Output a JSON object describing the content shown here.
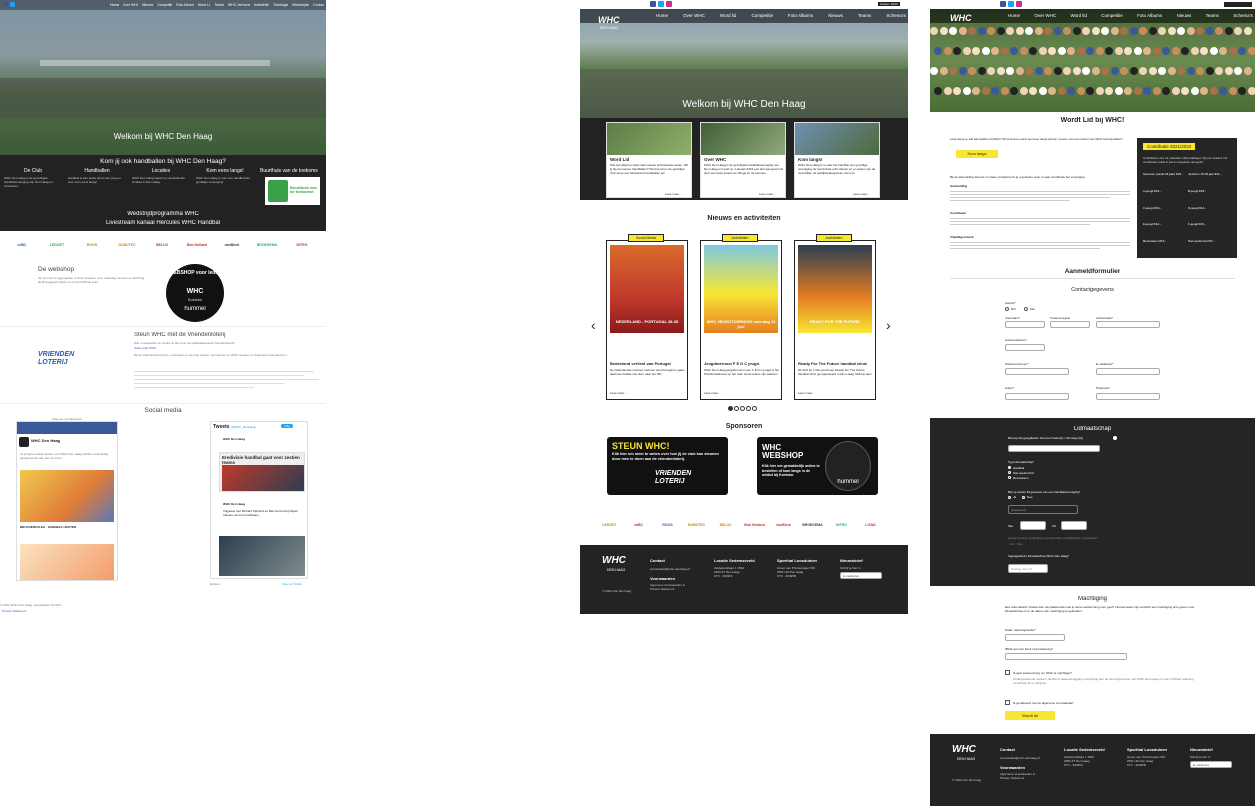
{
  "colors": {
    "accent_yellow": "#f7e733",
    "dark_bg": "#232323",
    "link_blue": "#2a5db0",
    "facebook_blue": "#3b5998"
  },
  "panel1": {
    "nav": [
      "Home",
      "Over WHC",
      "Nieuws",
      "Competitie",
      "Foto Albums",
      "Word Lid",
      "Teams",
      "WHC-Verhuren",
      "Activiteiten",
      "Trainingen",
      "Wedstrijden",
      "Contact"
    ],
    "hero_title": "Welkom bij WHC Den Haag",
    "question": "Kom jij ook handballen bij WHC Den Haag?",
    "columns": [
      {
        "title": "De Club",
        "text": "WHC Den Haag is de gezelligste handbalvereniging van Den Haag en omstreken."
      },
      {
        "title": "Handballen",
        "text": "Handbal is een leuke sport voor jong en oud. Kom eens langs!"
      },
      {
        "title": "Locaties",
        "text": "WHC Den Haag speelt op verschillende locaties in Den Haag."
      },
      {
        "title": "Kom eens langs!",
        "text": "WHC Den Haag is voor een handbal dat gezellige vereniging!"
      },
      {
        "title": "Buurthuis van de toekomst",
        "text": ""
      }
    ],
    "buurthuis_logo": "Buurthuis van de toekomst",
    "wedstrijd": "Wedstrijdprogramma WHC",
    "livestream": "Livestream kanaal Hercules WHC Handbal",
    "sponsors": [
      "vdBC",
      "LEDOET",
      "ROOS",
      "NOBUTEC",
      "BELUX",
      "Bob Holland",
      "vanBlerk",
      "BROEKEMA",
      "INTRO"
    ],
    "webshop_title": "De webshop",
    "webshop_text": "Op ons wimm leggi kleden of al de Koelsior, voor vaderdag mensen en dutching kleding gigand belast en op de KOM jou stad.",
    "webshop_badge": "WEBSHOP voor leden",
    "webshop_brand": "hummel",
    "webshop_club": "WHC",
    "webshop_partner": "Koelsior",
    "loterij_title": "Steun WHC met de Vriendenloterij",
    "loterij_q": "Wilt u meespelen en spelen je als meer de geldwaardewerk Vriendenloterij?",
    "loterij_link": "Steun mijn WHC",
    "loterij_text": "Bij de Vriendenloterij kunt u meedoen en uw prijs winnen. Het winnen en WHC steunen en financieel ondersteunen.",
    "loterij_logo": "VRIENDEN LOTERIJ",
    "social_title": "Social media",
    "fb_caption": "Volg ons op Facebook",
    "fb_page": "WHC Den Haag",
    "fb_post": "Je jongste enkele spelers van WHC Den Haag hebben vanmiddag deelgenomen aan een toernooi.",
    "fb_event": "BRUCHERCULES - HANDBAL HOUTEN",
    "tweets_header": "Tweets",
    "tweets_by": "@WHC_DenHaag",
    "tweets_follow": "Volg",
    "tweet1_name": "WHC Den Haag",
    "tweet1_title": "Eredivisie handbal gaat voor zestien teams",
    "tweet2_name": "WHC Den Haag",
    "tweet2_text": "Vrijgewel met Richard Sijbrand en Bart de Koning blijven trainers van het hoofdteam.",
    "tweet_embed": "Embed",
    "tweet_view": "View on Twitter",
    "copyright": "© 2022 WHC Den Haag. Aangesloten bij NHV.",
    "footer_links": "Privacy Statement"
  },
  "panel2": {
    "topbar_search": "Zoeken WHC",
    "logo": "WHC",
    "logo_sub": "DEN HAAG",
    "nav": [
      "Home",
      "Over WHC",
      "Word lid",
      "Competitie",
      "Foto Albums",
      "Nieuws",
      "Teams",
      "Schema's"
    ],
    "hero_title": "Welkom bij WHC Den Haag",
    "cards": [
      {
        "title": "Word Lid",
        "text": "Wie zijn altijd op zoek naar nieuwe enthousiaste leden. Wil jij bij ons komen handballen? Word je lid en de gezellige club zet je een fantastisch handballen op!",
        "more": "Lees meer..."
      },
      {
        "title": "Over WHC",
        "text": "WHC Den Haag is de gezelligste handbalvereniging van Den Haag en heeft op 1 januari 2019 een drempel gevormd door een fusie tussen de Wings en de Hermes.",
        "more": "Lees meer..."
      },
      {
        "title": "Kom langs!",
        "text": "WHC Den Haag is is naar het handbal een gezellige vereniging. Er wordt daar echt trainen en er spelen van de verschillen de leeftijdscategorieën van ons.",
        "more": "Lees meer..."
      }
    ],
    "news_title": "Nieuws en activiteiten",
    "news": [
      {
        "tag": "Social Media",
        "img_text": "NEDERLAND - PORTUGAL 28-35",
        "title": "Bedeeland verliest van Portugal",
        "text": "De Nederlandse mannen verloren van Portugal en gaan daarmee helaas niet door naar het WK.",
        "more": "Lees meer..."
      },
      {
        "tag": "Activiteiten",
        "img_text": "WHC JEUGDTOERNOOI zaterdag 11 juni",
        "title": "Jeugdtoernooi F E D C jeugd.",
        "text": "WHC Den Haag jeugdtoernooi voor F E D C jeugd is het Pinkstersiteknoot op het veld. Grote teams zijn welkom!",
        "more": "Lees meer..."
      },
      {
        "tag": "Activiteiten",
        "img_text": "READY FOR THE FUTURE",
        "title": "Ready For The Future handbal clinic",
        "text": "30 April en 1 Mei wordt een Ready For The Future handbal clinic georganiseerd in Den Haag. Meld je aan!",
        "more": "Lees meer..."
      }
    ],
    "sponsors_title": "Sponsoren",
    "sponsor_banners": [
      {
        "title": "STEUN WHC!",
        "text": "Klik hier om meer te weten over hoe jij de club kan steunen door mee te doen aan de vriendenloterij.",
        "logo": "VRIENDEN LOTERIJ"
      },
      {
        "title": "WHC WEBSHOP",
        "text": "Klik hier om gemakkelijk online te bestellen of kom langs in de winkel bij Koelsior.",
        "logo": "hummel"
      }
    ],
    "sponsor_logos": [
      "LEDOET",
      "vdBC",
      "ROOS",
      "NOBUTEC",
      "BELUX",
      "Bob Holland",
      "vanBlerk",
      "BROEKEMA",
      "INTRO",
      "LOWA"
    ],
    "footer": {
      "copyright": "© 2022 whc den haag",
      "contact_title": "Contact",
      "contact_email": "secretariaat@whc-denhaag.nl",
      "voorwaarden_title": "Voorwaarden",
      "voorwaarden_text": "Algemene Voorwaarden & Privacy Statement",
      "loc1_title": "Locatie Sedemseveld",
      "loc1_text": "Zuiderparklaan 1 1594\n2583 ZT Den Haag\nKTV - 30495C",
      "loc2_title": "Sporthal Loosduinen",
      "loc2_text": "Groen van Prinsterelaan 500\n2551 HD Den Haag\nKTV - 30495B",
      "news_title": "Nieuwsbrief",
      "news_text": "Schrijf je hier in",
      "news_placeholder": "E-mailadres"
    }
  },
  "panel3": {
    "nav": [
      "Home",
      "Over WHC",
      "Word lid",
      "Competitie",
      "Foto Albums",
      "Nieuws",
      "Teams",
      "Schema's"
    ],
    "title": "Wordt Lid bij WHC!",
    "intro": "Leuk dat je je wilt aanmelden bij WHC! Wil je binnen eerst een keer langs komen of even met een trainer van WHC kennismaken?",
    "btn_komlangs": "Kom langs",
    "contrib_title": "Contributie 2021/2022",
    "contrib_note": "Contributie voor 12 maanden. Bij betalingen zijn per maand. De contributie wordt in juli en augustus niet geint.",
    "contrib_items": [
      "Senioren (vanaf 18 jaar) €25,-",
      "Junioren 15-18 jaar €21,-",
      "A-jeugd €19,-",
      "B-jeugd €18,-",
      "C-jeugd €16,-",
      "D-jeugd €14,-",
      "E-jeugd €12,-",
      "F-jeugd €10,-",
      "Recreanten €15,-",
      "Niet spelend lid €7,-"
    ],
    "aanmelding_text": "Bij de aanmelding die hier en staan verwijst komt je u gesloten even en jaar contributie het vereniging.",
    "h_aanmelding": "Aanmelding",
    "h_contributie": "Contributie",
    "h_vrijwilligerswerk": "Vrijwilligerswerk",
    "form_title": "Aanmeldformulier",
    "contact_title": "Contactgegevens",
    "f_aanhef": "Aanhef*",
    "opt_dhr": "Dhr",
    "opt_mw": "Mw",
    "f_voornaam": "Voornaam*",
    "f_tussen": "Tussenvoegsel",
    "f_achternaam": "Achternaam*",
    "f_geboorte": "Geboortedatum*",
    "f_telefoon": "Telefoonnummer*",
    "f_email": "E-mailadres*",
    "f_adres": "Adres*",
    "f_postcode": "Postcode*",
    "lid_title": "Lidmaatschap",
    "f_lidsoort": "Bennep Eij (jeugdleden hiervoor Ouder(s) / Verzorger(s))",
    "f_type": "Type lidmaatschap*",
    "type_options": [
      "Handbal",
      "Niet spelend lid",
      "Recreanten"
    ],
    "f_eerder": "Ben je eerder lid geweest van een handbalvereniging?",
    "opt_ja": "Ja",
    "opt_nee": "Nee",
    "ph_vereniging": "geweest bij ...",
    "lbl_van": "Van",
    "lbl_tot": "Tot",
    "f_overschrijving": "Heb je bij deze vereniging nog financiële verplichtingen openstaan?",
    "f_ingangsdatum": "Ingangsdatum lidmaatschap WHC Den Haag*",
    "ph_ingangsdatum": "Huidige datum?",
    "machtiging_title": "Machtiging",
    "machtiging_text": "Een automatisch incasso kan uw plaatsvinden als je deze toestemming voor geeft. Nieuwe leden zijn verplicht een machtiging af te geven voor lidmaatschap en in de datum van machtiging te gebruiken.",
    "f_rekening": "Naam rekeninghouder*",
    "f_iban": "IBAN-nummer bank of girorekening*",
    "chk_toestemming": "Ik geef toestemming om WHC te machtigen*",
    "chk_note": "Ondergetekende verleent hierbij tot wederopzegging machtiging aan de penningmeester van WHC Den Haag om van zijn/haar rekening contributie af te schrijven.",
    "chk_voorwaarden": "Ik ga akkoord met de algemene voorwaarden*",
    "btn_submit": "Wordt lid",
    "footer": {
      "copyright": "© 2022 whc den haag",
      "contact_title": "Contact",
      "contact_email": "secretariaat@whc-denhaag.nl",
      "voorwaarden_title": "Voorwaarden",
      "voorwaarden_text": "Algemene Voorwaarden & Privacy Statement",
      "loc1_title": "Locatie Sedemseveld",
      "loc1_text": "Zuiderparklaan 1 1594\n2583 ZT Den Haag\nKTV - 30495C",
      "loc2_title": "Sporthal Loosduinen",
      "loc2_text": "Groen van Prinsterelaan 500\n2551 HD Den Haag\nKTV - 30495B",
      "news_title": "Nieuwsbrief",
      "news_text": "Schrijf je hier in",
      "news_placeholder": "E-mailadres"
    }
  }
}
